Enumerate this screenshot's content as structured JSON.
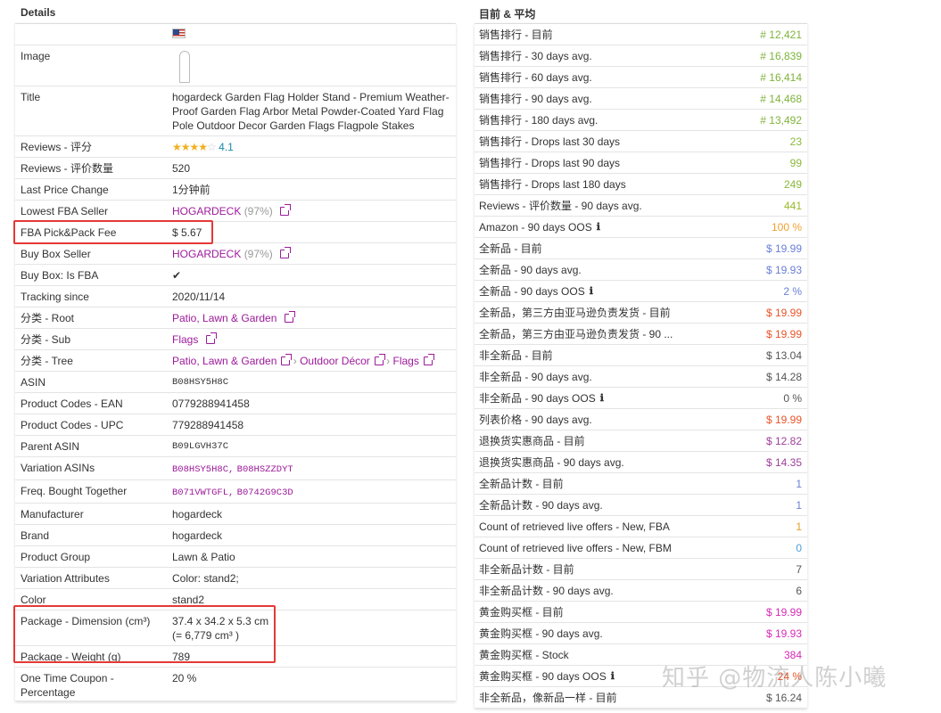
{
  "left": {
    "title": "Details",
    "image_label": "Image",
    "title_label": "Title",
    "title_value": "hogardeck Garden Flag Holder Stand - Premium Weather-Proof Garden Flag Arbor Metal Powder-Coated Yard Flag Pole Outdoor Decor Garden Flags Flagpole Stakes",
    "reviews_label": "Reviews - 评分",
    "reviews_value": "4.1",
    "review_count_label": "Reviews - 评价数量",
    "review_count_value": "520",
    "last_price_label": "Last Price Change",
    "last_price_value": "1分钟前",
    "lowest_fba_label": "Lowest FBA Seller",
    "lowest_fba_seller": "HOGARDECK",
    "lowest_fba_pct": "(97%)",
    "fba_fee_label": "FBA Pick&Pack Fee",
    "fba_fee_value": "$ 5.67",
    "buybox_seller_label": "Buy Box Seller",
    "buybox_seller": "HOGARDECK",
    "buybox_pct": "(97%)",
    "buybox_fba_label": "Buy Box: Is FBA",
    "buybox_fba_value": "✔",
    "tracking_label": "Tracking since",
    "tracking_value": "2020/11/14",
    "cat_root_label": "分类 - Root",
    "cat_root_value": "Patio, Lawn & Garden",
    "cat_sub_label": "分类 - Sub",
    "cat_sub_value": "Flags",
    "cat_tree_label": "分类 - Tree",
    "cat_tree_1": "Patio, Lawn & Garden",
    "cat_tree_2": "Outdoor Décor",
    "cat_tree_3": "Flags",
    "cat_sep": "›",
    "asin_label": "ASIN",
    "asin_value": "B08HSY5H8C",
    "ean_label": "Product Codes - EAN",
    "ean_value": "0779288941458",
    "upc_label": "Product Codes - UPC",
    "upc_value": "779288941458",
    "parent_label": "Parent ASIN",
    "parent_value": "B09LGVH37C",
    "variation_label": "Variation ASINs",
    "variation_1": "B08HSY5H8C,",
    "variation_2": "B08HSZZDYT",
    "freq_label": "Freq. Bought Together",
    "freq_1": "B071VWTGFL,",
    "freq_2": "B0742G9C3D",
    "manufacturer_label": "Manufacturer",
    "manufacturer_value": "hogardeck",
    "brand_label": "Brand",
    "brand_value": "hogardeck",
    "group_label": "Product Group",
    "group_value": "Lawn & Patio",
    "var_attr_label": "Variation Attributes",
    "var_attr_value": "Color: stand2;",
    "color_label": "Color",
    "color_value": "stand2",
    "dim_label": "Package - Dimension (cm³)",
    "dim_value": "37.4 x 34.2 x 5.3 cm",
    "dim_value2": "(= 6,779 cm³ )",
    "weight_label": "Package - Weight (g)",
    "weight_value": "789",
    "coupon_label": "One Time Coupon - Percentage",
    "coupon_value": "20 %"
  },
  "right": {
    "title": "目前 & 平均",
    "rows": [
      {
        "label": "销售排行 - 目前",
        "value": "# 12,421"
      },
      {
        "label": "销售排行 - 30 days avg.",
        "value": "# 16,839"
      },
      {
        "label": "销售排行 - 60 days avg.",
        "value": "# 16,414"
      },
      {
        "label": "销售排行 - 90 days avg.",
        "value": "# 14,468"
      },
      {
        "label": "销售排行 - 180 days avg.",
        "value": "# 13,492"
      },
      {
        "label": "销售排行 - Drops last 30 days",
        "value": "23"
      },
      {
        "label": "销售排行 - Drops last 90 days",
        "value": "99"
      },
      {
        "label": "销售排行 - Drops last 180 days",
        "value": "249"
      },
      {
        "label": "Reviews - 评价数量 - 90 days avg.",
        "value": "441"
      },
      {
        "label": "Amazon - 90 days OOS",
        "value": "100 %"
      },
      {
        "label": "全新品 - 目前",
        "value": "$ 19.99"
      },
      {
        "label": "全新品 - 90 days avg.",
        "value": "$ 19.93"
      },
      {
        "label": "全新品 - 90 days OOS",
        "value": "2 %"
      },
      {
        "label": "全新品，第三方由亚马逊负责发货 - 目前",
        "value": "$ 19.99"
      },
      {
        "label": "全新品，第三方由亚马逊负责发货 - 90 ...",
        "value": "$ 19.99"
      },
      {
        "label": "非全新品 - 目前",
        "value": "$ 13.04"
      },
      {
        "label": "非全新品 - 90 days avg.",
        "value": "$ 14.28"
      },
      {
        "label": "非全新品 - 90 days OOS",
        "value": "0 %"
      },
      {
        "label": "列表价格 - 90 days avg.",
        "value": "$ 19.99"
      },
      {
        "label": "退换货实惠商品 - 目前",
        "value": "$ 12.82"
      },
      {
        "label": "退换货实惠商品 - 90 days avg.",
        "value": "$ 14.35"
      },
      {
        "label": "全新品计数 - 目前",
        "value": "1"
      },
      {
        "label": "全新品计数 - 90 days avg.",
        "value": "1"
      },
      {
        "label": "Count of retrieved live offers - New, FBA",
        "value": "1"
      },
      {
        "label": "Count of retrieved live offers - New, FBM",
        "value": "0"
      },
      {
        "label": "非全新品计数 - 目前",
        "value": "7"
      },
      {
        "label": "非全新品计数 - 90 days avg.",
        "value": "6"
      },
      {
        "label": "黄金购买框 - 目前",
        "value": "$ 19.99"
      },
      {
        "label": "黄金购买框 - 90 days avg.",
        "value": "$ 19.93"
      },
      {
        "label": "黄金购买框 - Stock",
        "value": "384"
      },
      {
        "label": "黄金购买框 - 90 days OOS",
        "value": "24 %"
      },
      {
        "label": "非全新品，像新品一样 - 目前",
        "value": "$ 16.24"
      }
    ],
    "info_glyph": "ℹ"
  },
  "watermark": "知乎 @物流人陈小曦",
  "colors": {
    "link": "#9c1a9a",
    "highlight_box": "#e53935"
  }
}
